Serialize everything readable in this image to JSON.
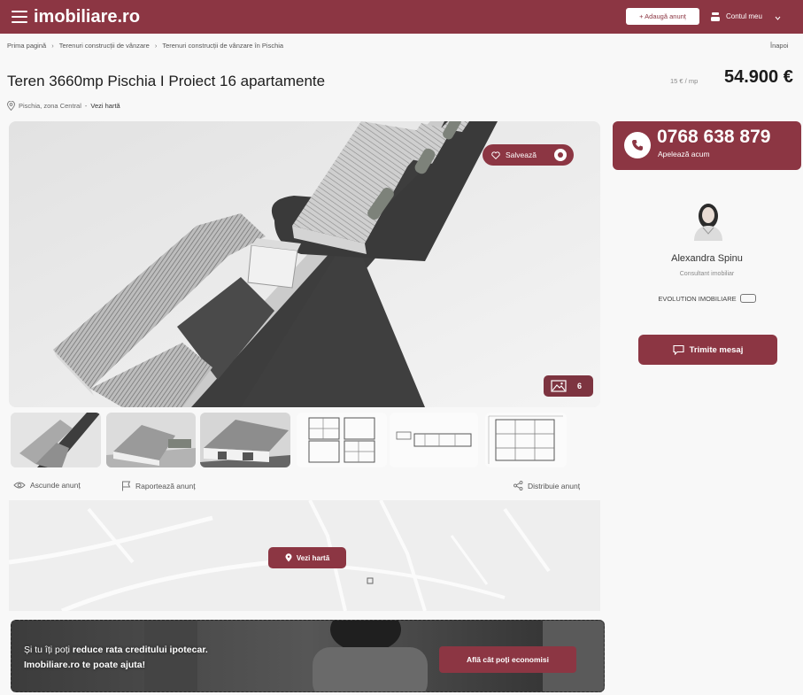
{
  "header": {
    "logo": "imobiliare.ro",
    "add_listing": "+ Adaugă anunț",
    "account": "Contul meu"
  },
  "breadcrumb": {
    "items": [
      "Prima pagină",
      "Terenuri construcții de vânzare",
      "Terenuri construcții de vânzare în Pischia"
    ],
    "separator": "›",
    "back": "Înapoi"
  },
  "listing": {
    "title": "Teren 3660mp Pischia I Proiect 16 apartamente",
    "price_per_unit": "15 € / mp",
    "price": "54.900 €",
    "location": "Pischia, zona Central",
    "location_separator": "-",
    "map_link": "Vezi hartă"
  },
  "gallery": {
    "save_label": "Salvează",
    "photo_count": "6"
  },
  "actions": {
    "hide": "Ascunde anunț",
    "report": "Raportează anunț",
    "share": "Distribuie anunț"
  },
  "map": {
    "button": "Vezi hartă"
  },
  "banner": {
    "text_intro": "Și tu îți poți ",
    "text_highlight": "reduce rata creditului ipotecar.",
    "text_line2": "Imobiliare.ro te poate ajuta!",
    "button": "Află cât poți economisi"
  },
  "contact": {
    "phone": "0768 638 879",
    "call_label": "Apelează acum",
    "agent_name": "Alexandra Spinu",
    "agent_role": "Consultant imobiliar",
    "agency": "EVOLUTION IMOBILIARE",
    "message_button": "Trimite mesaj"
  },
  "icons": {
    "menu": "menu-icon",
    "user": "user-icon",
    "chevron": "chevron-down-icon",
    "pin": "map-pin-icon",
    "heart": "heart-icon",
    "photos": "image-icon",
    "eye": "eye-icon",
    "flag": "flag-icon",
    "share": "share-icon",
    "phone": "phone-icon",
    "chat": "chat-icon"
  },
  "colors": {
    "brand": "#8c3643",
    "text": "#1d1d1d",
    "muted": "#8a8a8a",
    "background": "#f8f8f8"
  }
}
